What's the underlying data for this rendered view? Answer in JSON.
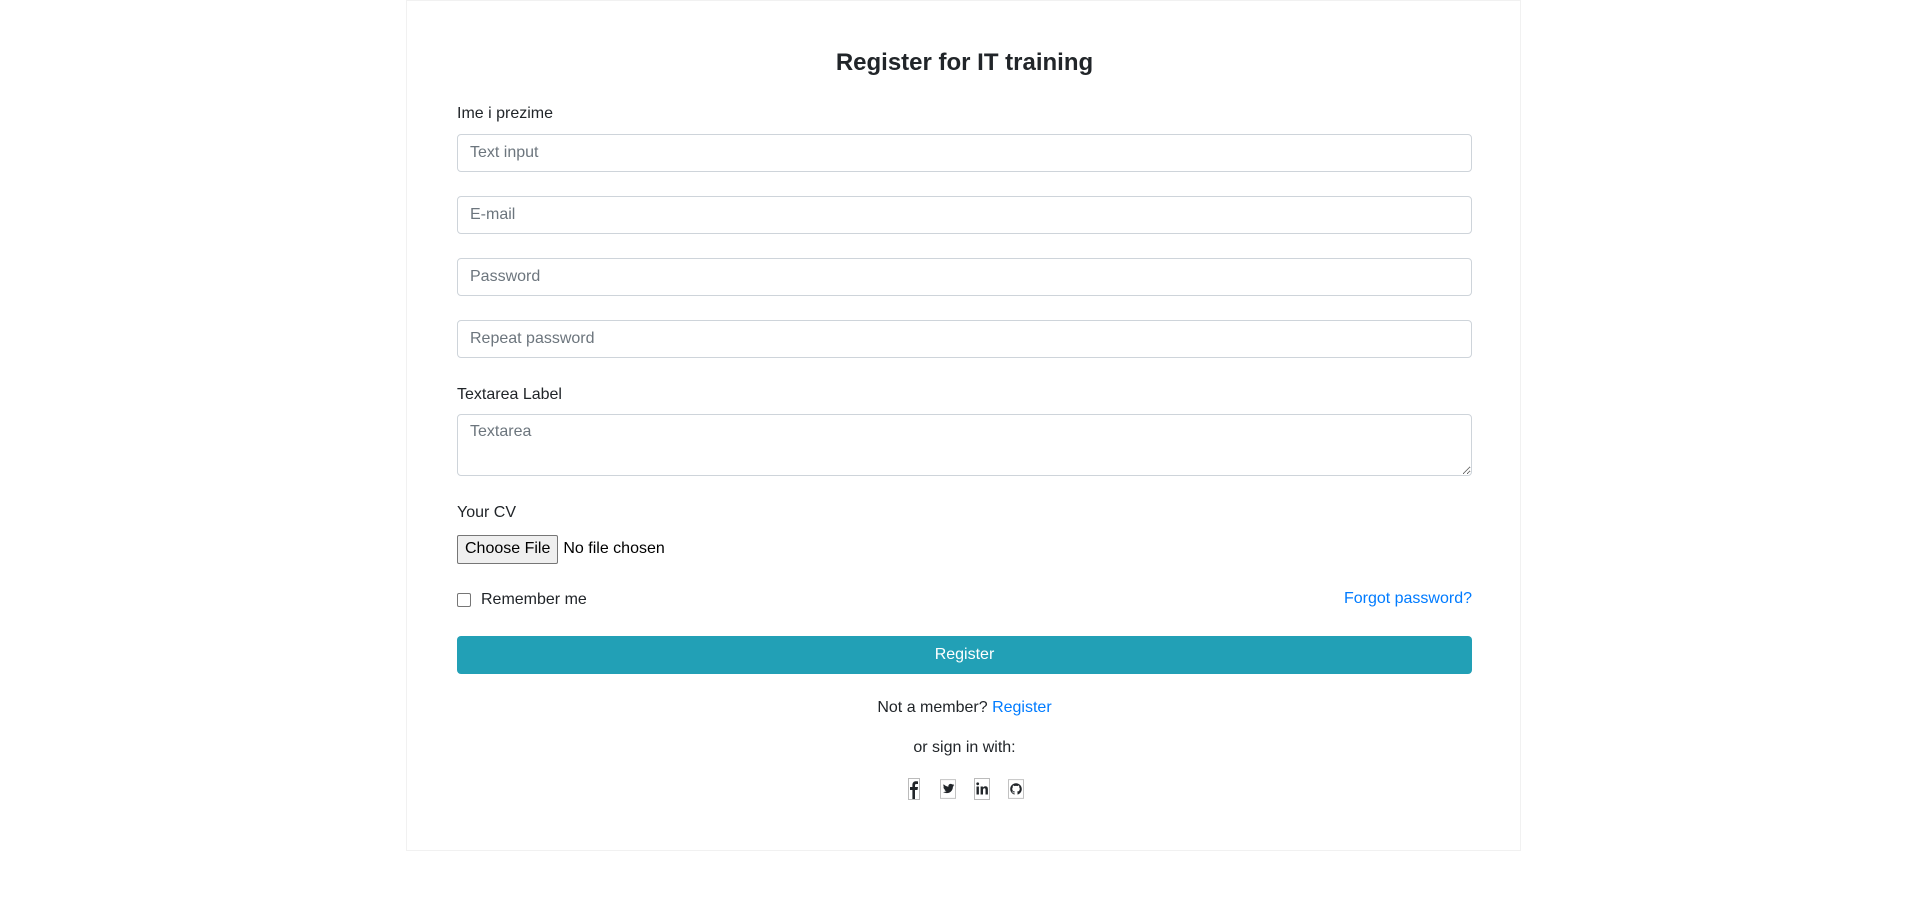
{
  "form": {
    "title": "Register for IT training",
    "name_label": "Ime i prezime",
    "name_placeholder": "Text input",
    "email_placeholder": "E-mail",
    "password_placeholder": "Password",
    "repeat_password_placeholder": "Repeat password",
    "textarea_label": "Textarea Label",
    "textarea_placeholder": "Textarea",
    "cv_label": "Your CV",
    "file_button_label": "Choose File",
    "file_status": "No file chosen",
    "remember_label": "Remember me",
    "remember_checked": false,
    "forgot_link": "Forgot password?",
    "submit_label": "Register",
    "not_member_text": "Not a member?",
    "register_link": "Register",
    "signin_with_text": "or sign in with:",
    "socials": [
      {
        "icon": "facebook-icon"
      },
      {
        "icon": "twitter-icon"
      },
      {
        "icon": "linkedin-icon"
      },
      {
        "icon": "github-icon"
      }
    ]
  },
  "colors": {
    "accent": "#22a0b6",
    "link": "#007bff",
    "text": "#212529",
    "placeholder": "#6c757d",
    "border": "#ced4da"
  }
}
